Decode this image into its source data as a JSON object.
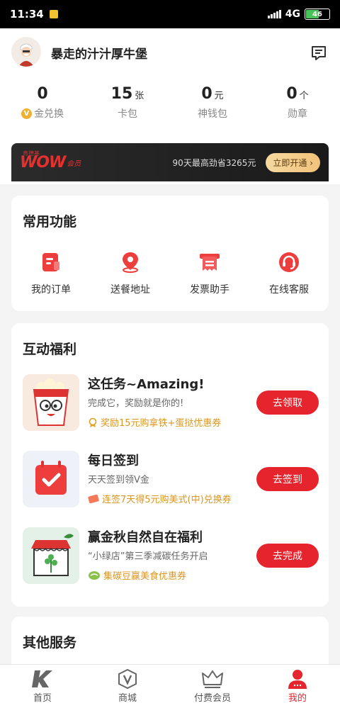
{
  "status_bar": {
    "time": "11:34",
    "network": "4G",
    "battery": "46"
  },
  "profile": {
    "username": "暴走的汁汁厚牛堡"
  },
  "stats": [
    {
      "value": "0",
      "unit": "",
      "label": "金兑换"
    },
    {
      "value": "15",
      "unit": "张",
      "label": "卡包"
    },
    {
      "value": "0",
      "unit": "元",
      "label": "神钱包"
    },
    {
      "value": "0",
      "unit": "个",
      "label": "勋章"
    }
  ],
  "banner": {
    "brand": "WOW",
    "brand_sub": "会员",
    "brand_top": "肯德基",
    "text": "90天最高劲省3265元",
    "button": "立即开通"
  },
  "common": {
    "title": "常用功能",
    "items": [
      {
        "label": "我的订单",
        "icon": "order-icon"
      },
      {
        "label": "送餐地址",
        "icon": "location-pin-icon"
      },
      {
        "label": "发票助手",
        "icon": "invoice-icon"
      },
      {
        "label": "在线客服",
        "icon": "headset-icon"
      }
    ]
  },
  "benefits": {
    "title": "互动福利",
    "tasks": [
      {
        "title": "这任务~Amazing!",
        "desc": "完成它，奖励就是你的!",
        "reward": "奖励15元购拿铁+蛋挞优惠券",
        "button": "去领取"
      },
      {
        "title": "每日签到",
        "desc": "天天签到领V金",
        "reward": "连签7天得5元购美式(中)兑换券",
        "button": "去签到"
      },
      {
        "title": "赢金秋自然自在福利",
        "desc": "“小绿店”第三季减碳任务开启",
        "reward": "集碳豆赢美食优惠券",
        "button": "去完成"
      }
    ]
  },
  "other": {
    "title": "其他服务"
  },
  "tabs": [
    {
      "label": "首页",
      "icon": "k-logo-icon"
    },
    {
      "label": "商城",
      "icon": "v-badge-icon"
    },
    {
      "label": "付费会员",
      "icon": "crown-icon"
    },
    {
      "label": "我的",
      "icon": "person-icon"
    }
  ],
  "colors": {
    "accent": "#e6242d",
    "reward": "#d99620"
  }
}
